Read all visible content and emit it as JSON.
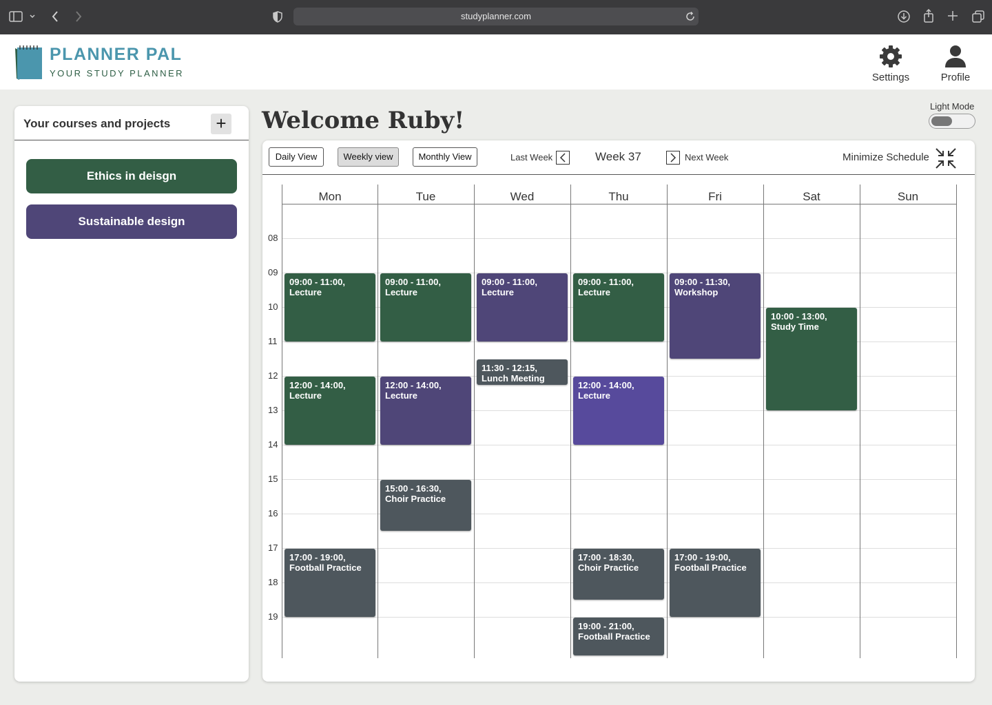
{
  "browser": {
    "url": "studyplanner.com"
  },
  "header": {
    "logo_title": "PLANNER PAL",
    "logo_subtitle": "YOUR STUDY PLANNER",
    "settings_label": "Settings",
    "profile_label": "Profile"
  },
  "sidebar": {
    "title": "Your courses and projects",
    "add_label": "+",
    "courses": [
      {
        "label": "Ethics in deisgn",
        "color": "#335e45"
      },
      {
        "label": "Sustainable design",
        "color": "#4f4678"
      }
    ]
  },
  "main": {
    "welcome": "Welcome Ruby!",
    "mode_label": "Light Mode",
    "views": [
      "Daily View",
      "Weekly view",
      "Monthly View"
    ],
    "active_view": "Weekly view",
    "last_week": "Last Week",
    "next_week": "Next Week",
    "week_label": "Week 37",
    "minimize_label": "Minimize Schedule"
  },
  "calendar": {
    "days": [
      "Mon",
      "Tue",
      "Wed",
      "Thu",
      "Fri",
      "Sat",
      "Sun"
    ],
    "hours": [
      "08",
      "09",
      "10",
      "11",
      "12",
      "13",
      "14",
      "15",
      "16",
      "17",
      "18",
      "19"
    ],
    "colors": {
      "green": "#335e45",
      "purple": "#4f4678",
      "violet": "#574a9c",
      "gray": "#4e575d"
    },
    "events": [
      {
        "day": 0,
        "start": 9,
        "end": 11,
        "time": "09:00 - 11:00,",
        "title": "Lecture",
        "color": "green"
      },
      {
        "day": 0,
        "start": 12,
        "end": 14,
        "time": "12:00 - 14:00,",
        "title": "Lecture",
        "color": "green"
      },
      {
        "day": 0,
        "start": 17,
        "end": 19,
        "time": "17:00 - 19:00,",
        "title": "Football Practice",
        "color": "gray"
      },
      {
        "day": 1,
        "start": 9,
        "end": 11,
        "time": "09:00 - 11:00,",
        "title": "Lecture",
        "color": "green"
      },
      {
        "day": 1,
        "start": 12,
        "end": 14,
        "time": "12:00 - 14:00,",
        "title": "Lecture",
        "color": "purple"
      },
      {
        "day": 1,
        "start": 15,
        "end": 16.5,
        "time": "15:00 - 16:30,",
        "title": "Choir Practice",
        "color": "gray"
      },
      {
        "day": 2,
        "start": 9,
        "end": 11,
        "time": "09:00 - 11:00,",
        "title": "Lecture",
        "color": "purple"
      },
      {
        "day": 2,
        "start": 11.5,
        "end": 12.25,
        "time": "11:30 - 12:15,",
        "title": "Lunch Meeting",
        "color": "gray"
      },
      {
        "day": 3,
        "start": 9,
        "end": 11,
        "time": "09:00 - 11:00,",
        "title": "Lecture",
        "color": "green"
      },
      {
        "day": 3,
        "start": 12,
        "end": 14,
        "time": "12:00 - 14:00,",
        "title": "Lecture",
        "color": "violet"
      },
      {
        "day": 3,
        "start": 17,
        "end": 18.5,
        "time": "17:00 - 18:30,",
        "title": "Choir Practice",
        "color": "gray"
      },
      {
        "day": 3,
        "start": 19,
        "end": 21,
        "time": "19:00 - 21:00,",
        "title": "Football Practice",
        "color": "gray"
      },
      {
        "day": 4,
        "start": 9,
        "end": 11.5,
        "time": "09:00 - 11:30,",
        "title": "Workshop",
        "color": "purple"
      },
      {
        "day": 4,
        "start": 17,
        "end": 19,
        "time": "17:00 - 19:00,",
        "title": "Football Practice",
        "color": "gray"
      },
      {
        "day": 5,
        "start": 10,
        "end": 13,
        "time": "10:00 - 13:00,",
        "title": "Study Time",
        "color": "green"
      }
    ]
  }
}
